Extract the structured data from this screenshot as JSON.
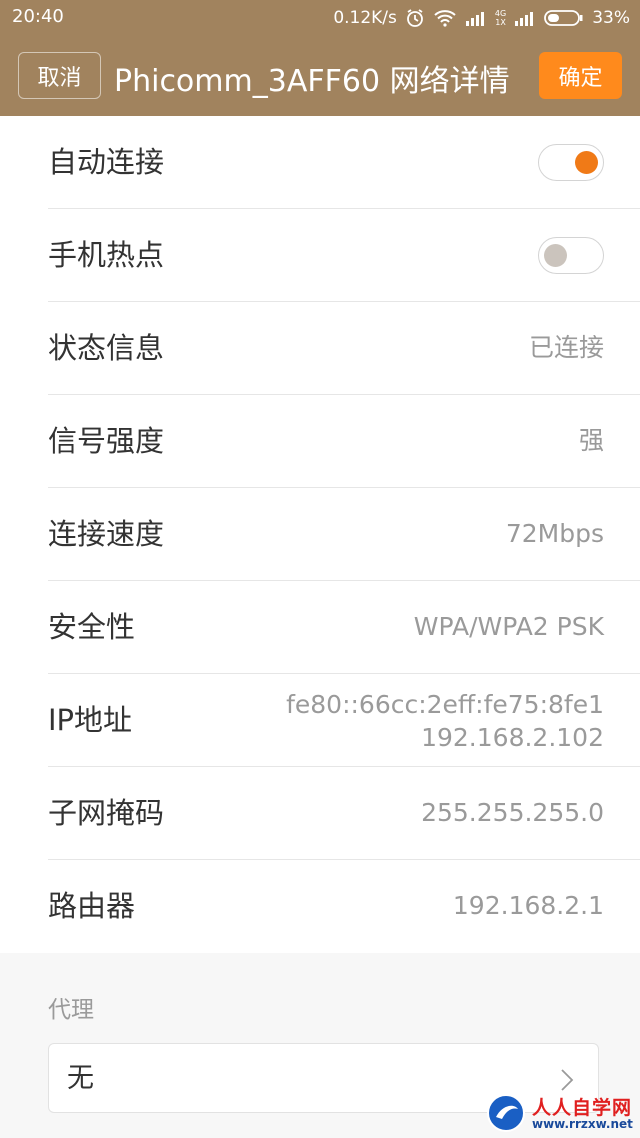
{
  "status_bar": {
    "time": "20:40",
    "speed": "0.12K/s",
    "network_top": "4G",
    "network_bottom": "1X",
    "battery": "33%"
  },
  "header": {
    "cancel_label": "取消",
    "title": "Phicomm_3AFF60 网络详情",
    "confirm_label": "确定"
  },
  "settings": {
    "auto_connect": {
      "label": "自动连接",
      "on": true
    },
    "hotspot": {
      "label": "手机热点",
      "on": false
    },
    "status": {
      "label": "状态信息",
      "value": "已连接"
    },
    "signal": {
      "label": "信号强度",
      "value": "强"
    },
    "speed": {
      "label": "连接速度",
      "value": "72Mbps"
    },
    "security": {
      "label": "安全性",
      "value": "WPA/WPA2 PSK"
    },
    "ip": {
      "label": "IP地址",
      "value_ipv6": "fe80::66cc:2eff:fe75:8fe1",
      "value_ipv4": "192.168.2.102"
    },
    "subnet": {
      "label": "子网掩码",
      "value": "255.255.255.0"
    },
    "router": {
      "label": "路由器",
      "value": "192.168.2.1"
    }
  },
  "proxy": {
    "label": "代理",
    "value": "无"
  },
  "watermark": {
    "text": "人人自学网",
    "url": "www.rrzxw.net"
  },
  "colors": {
    "header_bg": "#a1835e",
    "accent": "#ff8a1c",
    "toggle_on": "#f07a17"
  }
}
